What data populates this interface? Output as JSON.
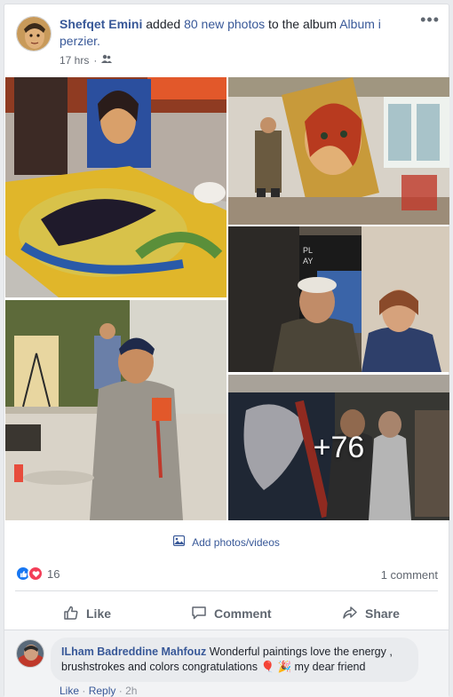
{
  "post": {
    "author": "Shefqet Emini",
    "action_text": " added ",
    "photo_count_link": "80 new photos",
    "to_album_text": " to the album ",
    "album_name": "Album i perzier.",
    "time": "17 hrs",
    "audience_icon": "friends-icon",
    "more_icon": "•••"
  },
  "photos": {
    "extra_count": "+76"
  },
  "add_photos": {
    "label": "Add photos/videos",
    "icon": "photo-icon"
  },
  "reactions": {
    "icons": [
      "like-icon",
      "love-icon"
    ],
    "count": "16",
    "comment_count": "1 comment"
  },
  "actions": {
    "like": "Like",
    "comment": "Comment",
    "share": "Share"
  },
  "comment": {
    "author": "ILham Badreddine Mahfouz",
    "text": "Wonderful paintings love the energy , brushstrokes and colors congratulations",
    "emojis": "🎈 🎉",
    "text_end": " my dear friend",
    "like": "Like",
    "reply": "Reply",
    "time": "2h"
  },
  "colors": {
    "link": "#385898",
    "muted": "#616770",
    "like_blue": "#1877f2",
    "love_red": "#f33e58"
  }
}
